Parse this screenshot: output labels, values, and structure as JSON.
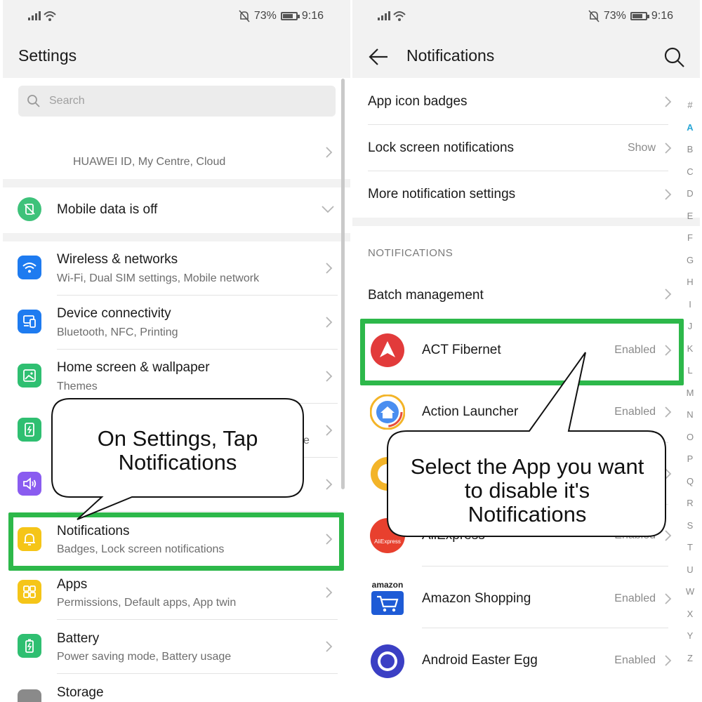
{
  "status_bar": {
    "battery": "73%",
    "time": "9:16"
  },
  "left": {
    "title": "Settings",
    "search_placeholder": "Search",
    "huawei_id": "HUAWEI ID, My Centre, Cloud",
    "mobile_data": "Mobile data is off",
    "items": [
      {
        "title": "Wireless & networks",
        "subtitle": "Wi-Fi, Dual SIM settings, Mobile network",
        "icon": "wifi-icon",
        "color": "#1e7bf0"
      },
      {
        "title": "Device connectivity",
        "subtitle": "Bluetooth, NFC, Printing",
        "icon": "device-connectivity-icon",
        "color": "#1e7bf0"
      },
      {
        "title": "Home screen & wallpaper",
        "subtitle": "Themes",
        "icon": "wallpaper-icon",
        "color": "#2fbf71"
      },
      {
        "title": "",
        "subtitle": "ze",
        "icon": "display-icon",
        "color": "#2fbf71"
      },
      {
        "title": "",
        "subtitle": "",
        "icon": "sound-icon",
        "color": "#8a5cf0"
      },
      {
        "title": "Notifications",
        "subtitle": "Badges, Lock screen notifications",
        "icon": "bell-icon",
        "color": "#f5c518"
      },
      {
        "title": "Apps",
        "subtitle": "Permissions, Default apps, App twin",
        "icon": "apps-icon",
        "color": "#f5c518"
      },
      {
        "title": "Battery",
        "subtitle": "Power saving mode, Battery usage",
        "icon": "battery-icon",
        "color": "#2fbf71"
      },
      {
        "title": "Storage",
        "subtitle": "",
        "icon": "storage-icon",
        "color": "#8a8a8a"
      }
    ],
    "callout": "On Settings, Tap Notifications"
  },
  "right": {
    "title": "Notifications",
    "settings": [
      {
        "title": "App icon badges",
        "value": ""
      },
      {
        "title": "Lock screen notifications",
        "value": "Show"
      },
      {
        "title": "More notification settings",
        "value": ""
      }
    ],
    "section_label": "NOTIFICATIONS",
    "batch": "Batch management",
    "apps": [
      {
        "name": "ACT Fibernet",
        "status": "Enabled"
      },
      {
        "name": "Action Launcher",
        "status": "Enabled"
      },
      {
        "name": "",
        "status": ""
      },
      {
        "name": "AliExpress",
        "status": "Enabled"
      },
      {
        "name": "Amazon Shopping",
        "status": "Enabled"
      },
      {
        "name": "Android Easter Egg",
        "status": "Enabled"
      }
    ],
    "amazon_logo_text": "amazon",
    "aliexpress_logo_text": "AliExpress",
    "alphabet": [
      "#",
      "A",
      "B",
      "C",
      "D",
      "E",
      "F",
      "G",
      "H",
      "I",
      "J",
      "K",
      "L",
      "M",
      "N",
      "O",
      "P",
      "Q",
      "R",
      "S",
      "T",
      "U",
      "W",
      "X",
      "Y",
      "Z"
    ],
    "callout": "Select the App you want to disable it's Notifications"
  },
  "colors": {
    "highlight": "#2db84a",
    "accent": "#2aa7d6"
  }
}
